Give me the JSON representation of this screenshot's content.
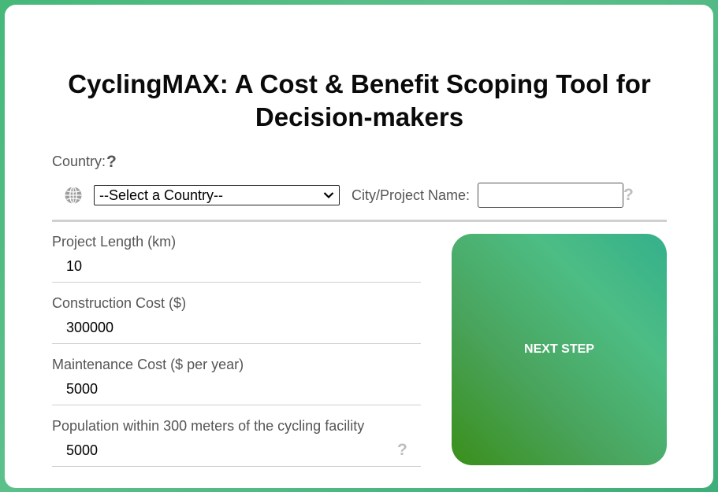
{
  "title": "CyclingMAX: A Cost & Benefit Scoping Tool for Decision-makers",
  "country": {
    "label": "Country:",
    "help": "?",
    "selected": "--Select a Country--"
  },
  "city": {
    "label": "City/Project Name:",
    "value": "",
    "help": "?"
  },
  "fields": [
    {
      "label": "Project Length (km)",
      "value": "10"
    },
    {
      "label": "Construction Cost ($)",
      "value": "300000"
    },
    {
      "label": "Maintenance Cost ($ per year)",
      "value": "5000"
    },
    {
      "label": "Population within 300 meters of the cycling facility",
      "value": "5000",
      "help": "?"
    }
  ],
  "next_button": "NEXT STEP",
  "icons": {
    "globe": "globe-icon",
    "help": "question-mark-icon",
    "dropdown": "chevron-down-icon"
  },
  "colors": {
    "background_green": "#46b87a",
    "button_green_dark": "#3a8f1a",
    "button_green_light": "#4dbd84",
    "text_gray": "#555555",
    "help_gray": "#bdbdbd"
  }
}
